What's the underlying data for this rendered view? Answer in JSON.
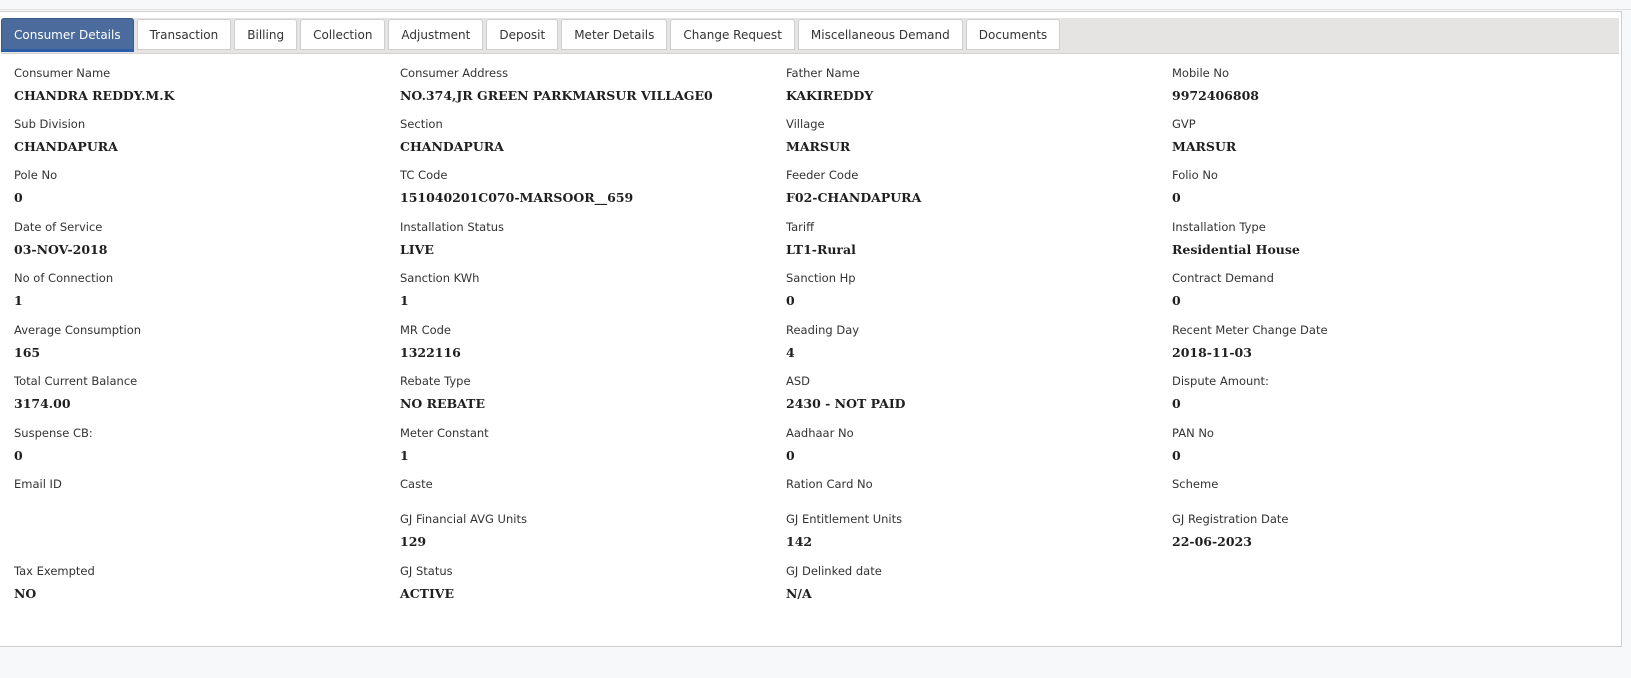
{
  "tabs": [
    {
      "label": "Consumer Details",
      "active": true
    },
    {
      "label": "Transaction",
      "active": false
    },
    {
      "label": "Billing",
      "active": false
    },
    {
      "label": "Collection",
      "active": false
    },
    {
      "label": "Adjustment",
      "active": false
    },
    {
      "label": "Deposit",
      "active": false
    },
    {
      "label": "Meter Details",
      "active": false
    },
    {
      "label": "Change Request",
      "active": false
    },
    {
      "label": "Miscellaneous Demand",
      "active": false
    },
    {
      "label": "Documents",
      "active": false
    }
  ],
  "fields": {
    "consumer_name": {
      "label": "Consumer Name",
      "value": "CHANDRA REDDY.M.K"
    },
    "consumer_address": {
      "label": "Consumer Address",
      "value": "NO.374,JR GREEN PARKMARSUR VILLAGE0"
    },
    "father_name": {
      "label": "Father Name",
      "value": "KAKIREDDY"
    },
    "mobile_no": {
      "label": "Mobile No",
      "value": "9972406808"
    },
    "sub_division": {
      "label": "Sub Division",
      "value": "CHANDAPURA"
    },
    "section": {
      "label": "Section",
      "value": "CHANDAPURA"
    },
    "village": {
      "label": "Village",
      "value": "MARSUR"
    },
    "gvp": {
      "label": "GVP",
      "value": "MARSUR"
    },
    "pole_no": {
      "label": "Pole No",
      "value": "0"
    },
    "tc_code": {
      "label": "TC Code",
      "value": "151040201C070-MARSOOR__659"
    },
    "feeder_code": {
      "label": "Feeder Code",
      "value": "F02-CHANDAPURA"
    },
    "folio_no": {
      "label": "Folio No",
      "value": "0"
    },
    "date_of_service": {
      "label": "Date of Service",
      "value": "03-NOV-2018"
    },
    "installation_status": {
      "label": "Installation Status",
      "value": "LIVE"
    },
    "tariff": {
      "label": "Tariff",
      "value": "LT1-Rural"
    },
    "installation_type": {
      "label": "Installation Type",
      "value": "Residential House"
    },
    "no_of_connection": {
      "label": "No of Connection",
      "value": "1"
    },
    "sanction_kwh": {
      "label": "Sanction KWh",
      "value": "1"
    },
    "sanction_hp": {
      "label": "Sanction Hp",
      "value": "0"
    },
    "contract_demand": {
      "label": "Contract Demand",
      "value": "0"
    },
    "average_consumption": {
      "label": "Average Consumption",
      "value": "165"
    },
    "mr_code": {
      "label": "MR Code",
      "value": "1322116"
    },
    "reading_day": {
      "label": "Reading Day",
      "value": "4"
    },
    "recent_meter_change_date": {
      "label": "Recent Meter Change Date",
      "value": "2018-11-03"
    },
    "total_current_balance": {
      "label": "Total Current Balance",
      "value": "3174.00"
    },
    "rebate_type": {
      "label": "Rebate Type",
      "value": "NO REBATE"
    },
    "asd": {
      "label": "ASD",
      "value": "2430 - NOT PAID"
    },
    "dispute_amount": {
      "label": "Dispute Amount:",
      "value": "0"
    },
    "suspense_cb": {
      "label": "Suspense CB:",
      "value": "0"
    },
    "meter_constant": {
      "label": "Meter Constant",
      "value": "1"
    },
    "aadhaar_no": {
      "label": "Aadhaar No",
      "value": "0"
    },
    "pan_no": {
      "label": "PAN No",
      "value": "0"
    },
    "email_id": {
      "label": "Email ID",
      "value": ""
    },
    "caste": {
      "label": "Caste",
      "value": ""
    },
    "ration_card_no": {
      "label": "Ration Card No",
      "value": ""
    },
    "scheme": {
      "label": "Scheme",
      "value": ""
    },
    "gj_financial_avg_units": {
      "label": "GJ Financial AVG Units",
      "value": "129"
    },
    "gj_entitlement_units": {
      "label": "GJ Entitlement Units",
      "value": "142"
    },
    "gj_registration_date": {
      "label": "GJ Registration Date",
      "value": "22-06-2023"
    },
    "tax_exempted": {
      "label": "Tax Exempted",
      "value": "NO"
    },
    "gj_status": {
      "label": "GJ Status",
      "value": "ACTIVE"
    },
    "gj_delinked_date": {
      "label": "GJ Delinked date",
      "value": "N/A"
    }
  },
  "colors": {
    "active_tab_bg": "#4a6b9b",
    "active_tab_border": "#2d5ca8",
    "tabbar_bg": "#e6e4e3"
  }
}
